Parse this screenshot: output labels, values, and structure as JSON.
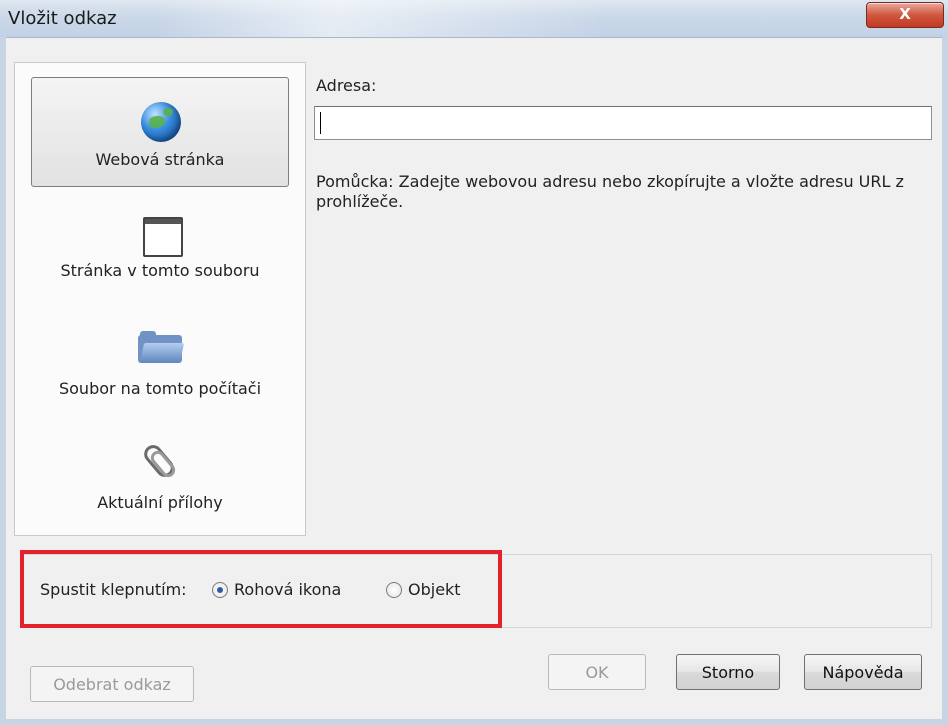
{
  "dialog": {
    "title": "Vložit odkaz",
    "close_glyph": "X"
  },
  "nav": {
    "items": [
      {
        "label": "Webová stránka",
        "icon": "globe-icon",
        "selected": true
      },
      {
        "label": "Stránka v tomto souboru",
        "icon": "window-icon",
        "selected": false
      },
      {
        "label": "Soubor na tomto počítači",
        "icon": "folder-icon",
        "selected": false
      },
      {
        "label": "Aktuální přílohy",
        "icon": "paperclip-icon",
        "selected": false
      }
    ]
  },
  "address": {
    "label": "Adresa:",
    "value": "",
    "hint": "Pomůcka: Zadejte webovou adresu nebo zkopírujte a vložte adresu URL z prohlížeče."
  },
  "trigger": {
    "label": "Spustit klepnutím:",
    "options": [
      {
        "label": "Rohová ikona",
        "checked": true
      },
      {
        "label": "Objekt",
        "checked": false
      }
    ],
    "highlight_color": "#e3222c"
  },
  "buttons": {
    "remove": "Odebrat odkaz",
    "ok": "OK",
    "cancel": "Storno",
    "help": "Nápověda"
  }
}
